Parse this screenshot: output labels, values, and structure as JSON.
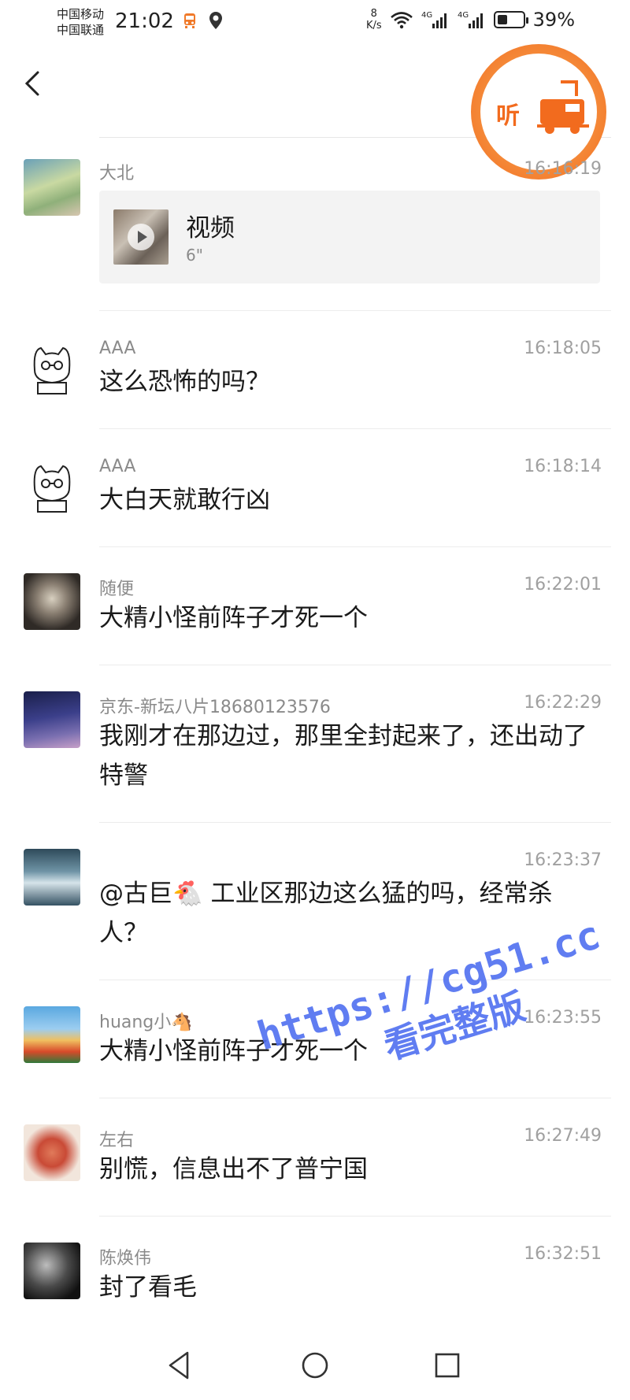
{
  "status_bar": {
    "carrier_1": "中国移动",
    "carrier_2": "中国联通",
    "time": "21:02",
    "speed_value": "8",
    "speed_unit": "K/s",
    "network_1": "4G",
    "network_2": "4G",
    "battery": "39%",
    "battery_level": 0.39
  },
  "header": {
    "listen_label": "听"
  },
  "messages": [
    {
      "sender": "大北",
      "time": "16:16:19",
      "type": "video",
      "video_title": "视频",
      "video_duration": "6\""
    },
    {
      "sender": "AAA",
      "time": "16:18:05",
      "text": "这么恐怖的吗？"
    },
    {
      "sender": "AAA",
      "time": "16:18:14",
      "text": "大白天就敢行凶"
    },
    {
      "sender": "随便",
      "time": "16:22:01",
      "text": "大精小怪前阵子才死一个"
    },
    {
      "sender": "京东-新坛八片18680123576",
      "time": "16:22:29",
      "text": "我刚才在那边过，那里全封起来了，还出动了特警"
    },
    {
      "sender": "",
      "time": "16:23:37",
      "text": "@古巨🐔 工业区那边这么猛的吗，经常杀人？"
    },
    {
      "sender": "huang小🐴",
      "time": "16:23:55",
      "text": "大精小怪前阵子才死一个"
    },
    {
      "sender": "左右",
      "time": "16:27:49",
      "text": "别慌，信息出不了普宁国"
    },
    {
      "sender": "陈焕伟",
      "time": "16:32:51",
      "text": "封了看毛"
    }
  ],
  "watermark": {
    "line1": "https://cg51.cc",
    "line2": "看完整版"
  },
  "colors": {
    "accent_orange": "#f26b1e",
    "watermark_blue": "#4f6ff0"
  },
  "icons": [
    "back-icon",
    "listen-truck-icon",
    "play-icon",
    "nav-back-icon",
    "nav-home-icon",
    "nav-recents-icon"
  ]
}
